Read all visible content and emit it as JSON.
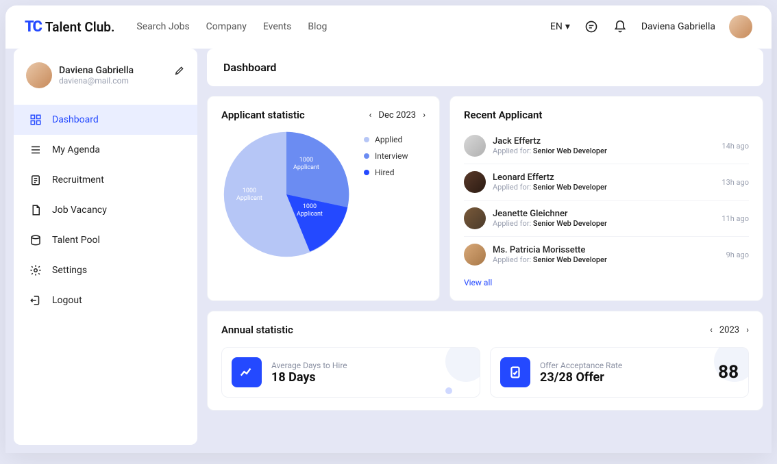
{
  "brand": {
    "mark": "TC",
    "name": "Talent Club."
  },
  "topnav": {
    "search_jobs": "Search Jobs",
    "company": "Company",
    "events": "Events",
    "blog": "Blog"
  },
  "header": {
    "lang": "EN",
    "username": "Daviena Gabriella"
  },
  "profile": {
    "name": "Daviena Gabriella",
    "email": "daviena@mail.com"
  },
  "sidebar": {
    "items": [
      {
        "label": "Dashboard"
      },
      {
        "label": "My Agenda"
      },
      {
        "label": "Recruitment"
      },
      {
        "label": "Job Vacancy"
      },
      {
        "label": "Talent Pool"
      },
      {
        "label": "Settings"
      },
      {
        "label": "Logout"
      }
    ]
  },
  "page": {
    "title": "Dashboard"
  },
  "applicant_stat": {
    "title": "Applicant statistic",
    "period": "Dec 2023",
    "legend": {
      "applied": "Applied",
      "interview": "Interview",
      "hired": "Hired"
    },
    "slice_labels": {
      "applied_count": "1000",
      "applied_word": "Applicant",
      "interview_count": "1000",
      "interview_word": "Applicant",
      "hired_count": "1000",
      "hired_word": "Applicant"
    },
    "colors": {
      "applied": "#b6c6f6",
      "interview": "#6b8cf2",
      "hired": "#2449ff"
    }
  },
  "chart_data": {
    "type": "pie",
    "title": "Applicant statistic",
    "series": [
      {
        "name": "Applied",
        "value": 1000,
        "color": "#b6c6f6"
      },
      {
        "name": "Interview",
        "value": 1000,
        "color": "#6b8cf2"
      },
      {
        "name": "Hired",
        "value": 1000,
        "color": "#2449ff"
      }
    ]
  },
  "recent": {
    "title": "Recent Applicant",
    "for_label": "Applied for: ",
    "view_all": "View all",
    "items": [
      {
        "name": "Jack Effertz",
        "position": "Senior Web Developer",
        "time": "14h ago"
      },
      {
        "name": "Leonard Effertz",
        "position": "Senior Web Developer",
        "time": "13h ago"
      },
      {
        "name": "Jeanette Gleichner",
        "position": "Senior Web Developer",
        "time": "11h ago"
      },
      {
        "name": "Ms. Patricia Morissette",
        "position": "Senior Web Developer",
        "time": "9h ago"
      }
    ]
  },
  "annual": {
    "title": "Annual statistic",
    "year": "2023",
    "metrics": [
      {
        "label": "Average Days to Hire",
        "value": "18 Days"
      },
      {
        "label": "Offer Acceptance Rate",
        "value": "23/28 Offer",
        "big": "88"
      }
    ]
  }
}
